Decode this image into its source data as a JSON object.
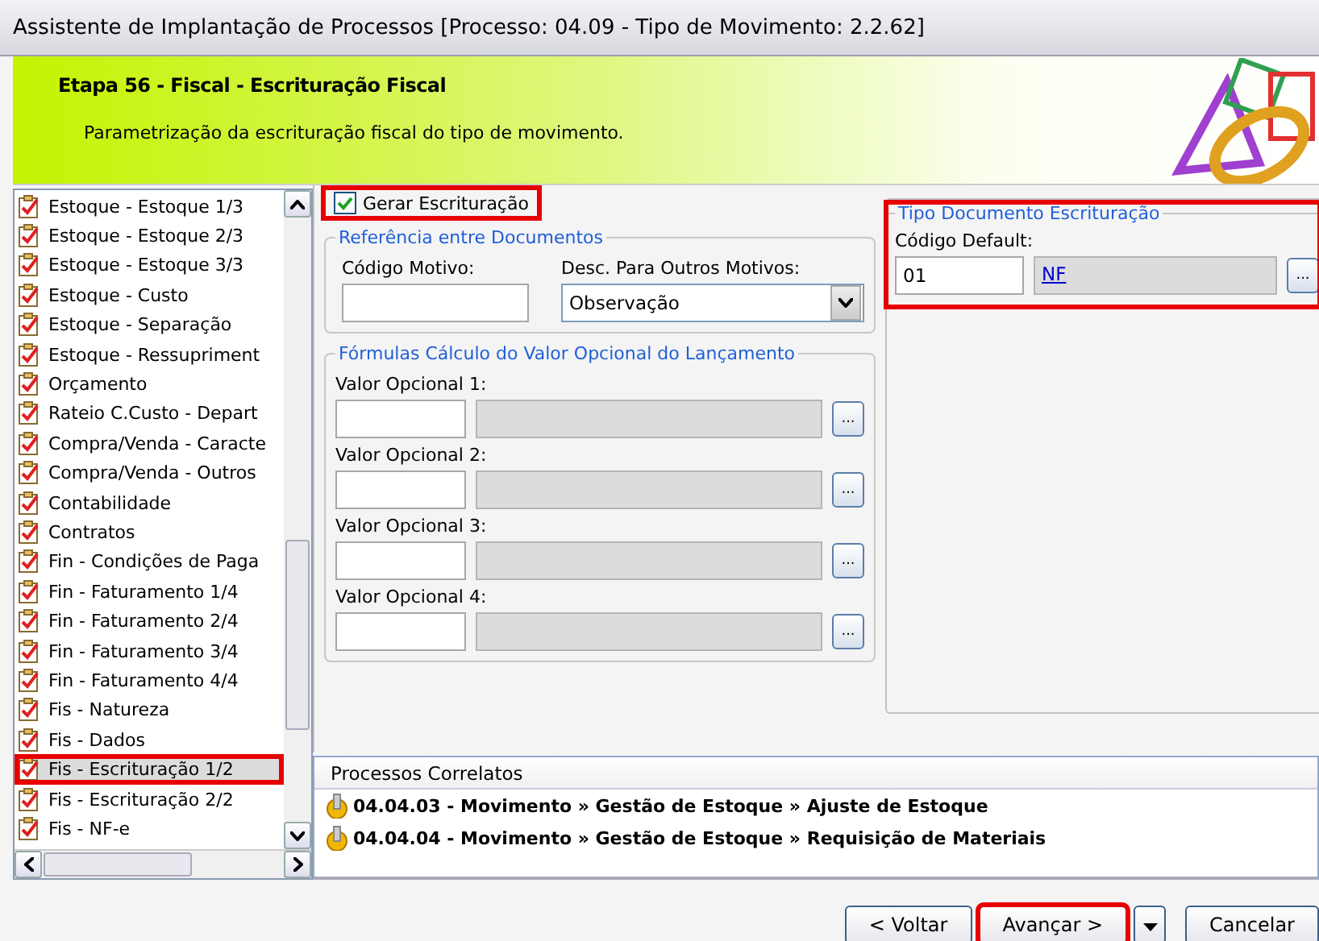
{
  "window": {
    "title": "Assistente de Implantação de Processos [Processo: 04.09 - Tipo de Movimento: 2.2.62]"
  },
  "header": {
    "step": "Etapa 56 - Fiscal - Escrituração Fiscal",
    "description": "Parametrização da escrituração fiscal do tipo de movimento."
  },
  "steps": [
    {
      "label": "Estoque - Estoque 1/3",
      "selected": false,
      "highlighted": false
    },
    {
      "label": "Estoque - Estoque 2/3",
      "selected": false,
      "highlighted": false
    },
    {
      "label": "Estoque - Estoque 3/3",
      "selected": false,
      "highlighted": false
    },
    {
      "label": "Estoque - Custo",
      "selected": false,
      "highlighted": false
    },
    {
      "label": "Estoque - Separação",
      "selected": false,
      "highlighted": false
    },
    {
      "label": "Estoque - Ressupriment",
      "selected": false,
      "highlighted": false
    },
    {
      "label": "Orçamento",
      "selected": false,
      "highlighted": false
    },
    {
      "label": "Rateio C.Custo - Depart",
      "selected": false,
      "highlighted": false
    },
    {
      "label": "Compra/Venda - Caracte",
      "selected": false,
      "highlighted": false
    },
    {
      "label": "Compra/Venda - Outros",
      "selected": false,
      "highlighted": false
    },
    {
      "label": "Contabilidade",
      "selected": false,
      "highlighted": false
    },
    {
      "label": "Contratos",
      "selected": false,
      "highlighted": false
    },
    {
      "label": "Fin - Condições de Paga",
      "selected": false,
      "highlighted": false
    },
    {
      "label": "Fin - Faturamento 1/4",
      "selected": false,
      "highlighted": false
    },
    {
      "label": "Fin - Faturamento 2/4",
      "selected": false,
      "highlighted": false
    },
    {
      "label": "Fin - Faturamento 3/4",
      "selected": false,
      "highlighted": false
    },
    {
      "label": "Fin - Faturamento 4/4",
      "selected": false,
      "highlighted": false
    },
    {
      "label": "Fis - Natureza",
      "selected": false,
      "highlighted": false
    },
    {
      "label": "Fis - Dados",
      "selected": false,
      "highlighted": false
    },
    {
      "label": "Fis - Escrituração 1/2",
      "selected": true,
      "highlighted": true
    },
    {
      "label": "Fis - Escrituração 2/2",
      "selected": false,
      "highlighted": false
    },
    {
      "label": "Fis - NF-e",
      "selected": false,
      "highlighted": false
    }
  ],
  "gerar": {
    "label": "Gerar Escrituração",
    "checked": true,
    "highlighted": true
  },
  "referencia": {
    "title": "Referência entre Documentos",
    "codigo_label": "Código Motivo:",
    "desc_label": "Desc. Para Outros Motivos:",
    "desc_value": "Observação"
  },
  "formulas": {
    "title": "Fórmulas Cálculo do Valor Opcional do Lançamento",
    "rows": [
      {
        "label": "Valor Opcional 1:",
        "button": "..."
      },
      {
        "label": "Valor Opcional 2:",
        "button": "..."
      },
      {
        "label": "Valor Opcional 3:",
        "button": "..."
      },
      {
        "label": "Valor Opcional 4:",
        "button": "..."
      }
    ]
  },
  "tipo_documento": {
    "title": "Tipo Documento Escrituração",
    "label": "Código Default:",
    "code": "01",
    "link": "NF",
    "button": "...",
    "highlighted": true
  },
  "related": {
    "title": "Processos Correlatos",
    "items": [
      "04.04.03 - Movimento » Gestão de Estoque » Ajuste de Estoque",
      "04.04.04 - Movimento » Gestão de Estoque » Requisição de Materiais"
    ]
  },
  "buttons": [
    {
      "label": "< Voltar",
      "kind": "button",
      "highlighted": false
    },
    {
      "label": "Avançar >",
      "kind": "button",
      "highlighted": true
    },
    {
      "kind": "dropdown",
      "highlighted": false
    },
    {
      "label": "Cancelar",
      "kind": "button",
      "highlighted": false
    }
  ]
}
